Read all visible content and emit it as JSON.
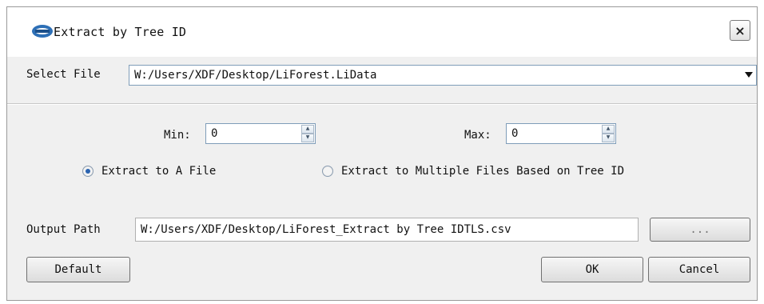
{
  "window": {
    "title": "Extract by Tree ID",
    "close_label": "×"
  },
  "select_file": {
    "label": "Select File",
    "value": "W:/Users/XDF/Desktop/LiForest.LiData"
  },
  "min": {
    "label": "Min:",
    "value": "0"
  },
  "max": {
    "label": "Max:",
    "value": "0"
  },
  "extract_options": {
    "single": {
      "label": "Extract to A File",
      "checked": true
    },
    "multiple": {
      "label": "Extract to Multiple Files Based on Tree ID",
      "checked": false
    }
  },
  "output": {
    "label": "Output Path",
    "value": "W:/Users/XDF/Desktop/LiForest_Extract by Tree IDTLS.csv",
    "browse_label": "..."
  },
  "buttons": {
    "default_label": "Default",
    "ok_label": "OK",
    "cancel_label": "Cancel"
  },
  "colors": {
    "dialog_bg": "#f0f0f0",
    "input_border": "#7f9db9",
    "radio_selected": "#2a63b0"
  },
  "icons": {
    "logo": "app-logo-icon",
    "close": "close-icon",
    "dropdown": "chevron-down-icon"
  }
}
